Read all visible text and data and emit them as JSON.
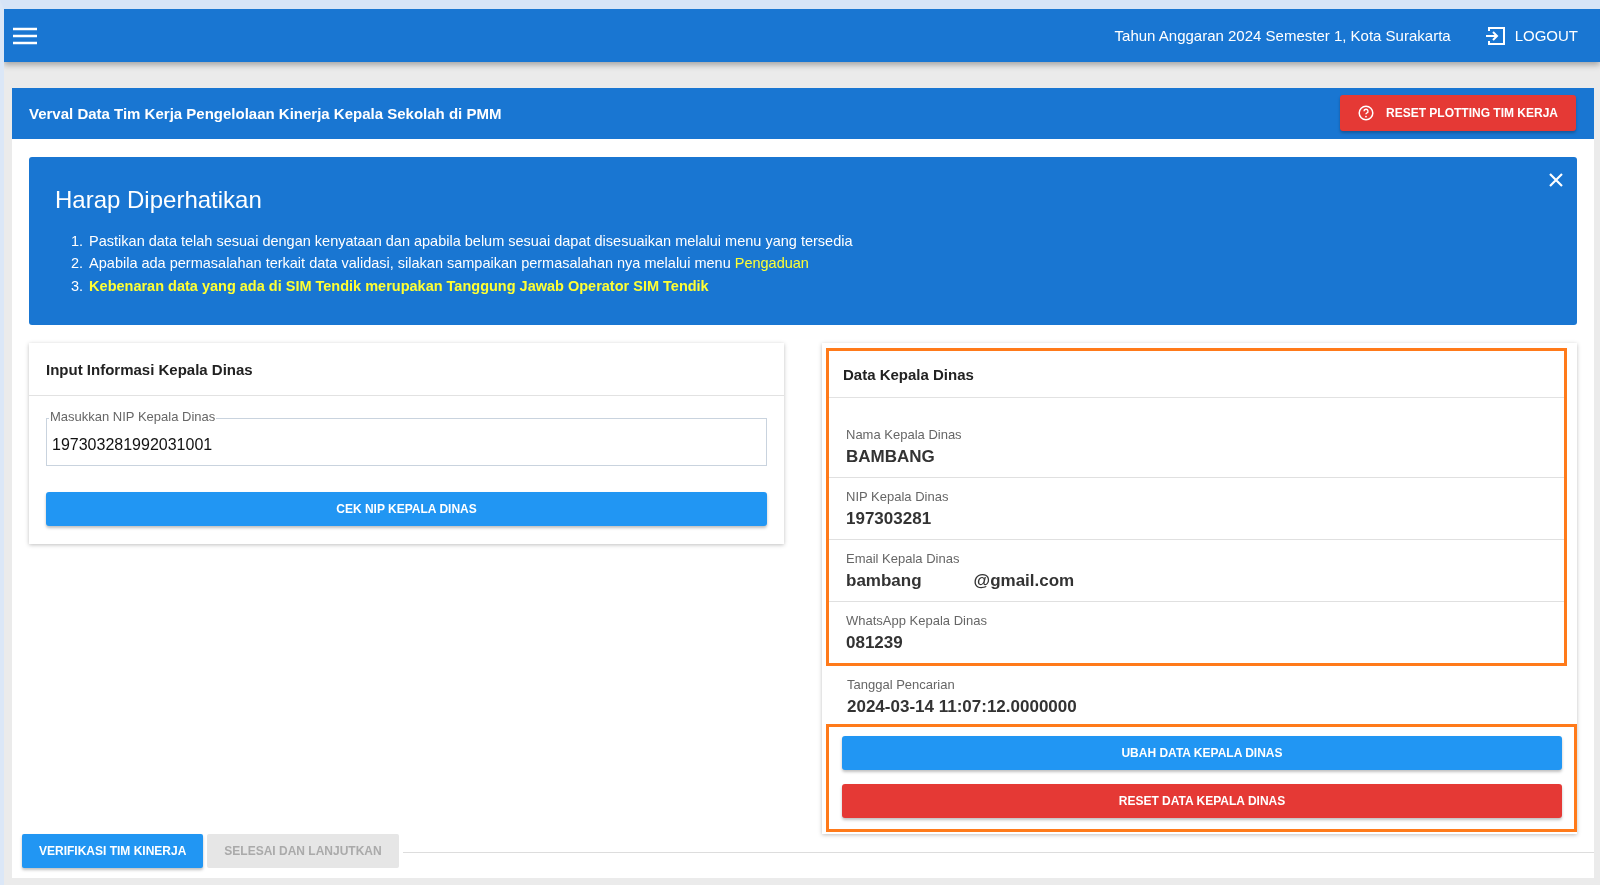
{
  "topbar": {
    "context": "Tahun Anggaran 2024 Semester 1, Kota Surakarta",
    "logout": "LOGOUT"
  },
  "page": {
    "title": "Verval Data Tim Kerja Pengelolaan Kinerja Kepala Sekolah di PMM",
    "reset_button": "RESET PLOTTING TIM KERJA"
  },
  "notice": {
    "title": "Harap Diperhatikan",
    "items": [
      {
        "number": "1.",
        "text": "Pastikan data telah sesuai dengan kenyataan dan apabila belum sesuai dapat disesuaikan melalui menu yang tersedia",
        "highlighted": false
      },
      {
        "number": "2.",
        "text": "Apabila ada permasalahan terkait data validasi, silakan sampaikan permasalahan nya melalui menu",
        "link": "Pengaduan",
        "highlighted": false
      },
      {
        "number": "3.",
        "text": "Kebenaran data yang ada di SIM Tendik merupakan Tanggung Jawab Operator SIM Tendik",
        "highlighted": true
      }
    ]
  },
  "input_card": {
    "title": "Input Informasi Kepala Dinas",
    "field": {
      "label": "Masukkan NIP Kepala Dinas",
      "value": "197303281992031001"
    },
    "button": "CEK NIP KEPALA DINAS"
  },
  "data_card": {
    "title": "Data Kepala Dinas",
    "fields": [
      {
        "label": "Nama Kepala Dinas",
        "value_parts": [
          "BAMBANG"
        ]
      },
      {
        "label": "NIP Kepala Dinas",
        "value_parts": [
          "197303281"
        ]
      },
      {
        "label": "Email Kepala Dinas",
        "value_parts": [
          "bambang",
          "@gmail.com"
        ]
      },
      {
        "label": "WhatsApp Kepala Dinas",
        "value_parts": [
          "081239"
        ]
      }
    ],
    "search_date": {
      "label": "Tanggal Pencarian",
      "value": "2024-03-14 11:07:12.0000000"
    },
    "buttons": [
      {
        "label": "UBAH DATA KEPALA DINAS",
        "kind": "primary"
      },
      {
        "label": "RESET DATA KEPALA DINAS",
        "kind": "danger"
      }
    ]
  },
  "steps": [
    {
      "label": "VERIFIKASI TIM KINERJA",
      "selected": true
    },
    {
      "label": "SELESAI DAN LANJUTKAN",
      "selected": false
    }
  ]
}
